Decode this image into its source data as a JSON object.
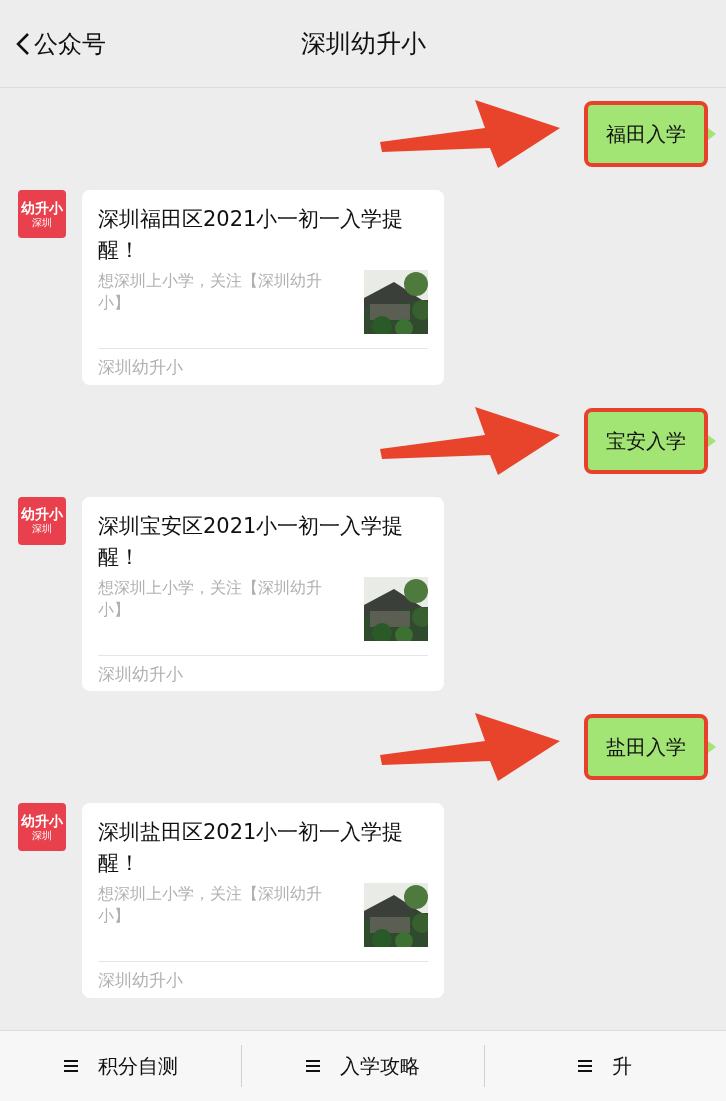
{
  "header": {
    "back_label": "公众号",
    "title": "深圳幼升小"
  },
  "messages": [
    {
      "kind": "sent",
      "text": "福田入学",
      "highlighted": true
    },
    {
      "kind": "article",
      "avatar": {
        "brand": "幼升小",
        "sub": "深圳"
      },
      "title": "深圳福田区2021小一初一入学提醒！",
      "summary": "想深圳上小学，关注【深圳幼升小】",
      "source": "深圳幼升小"
    },
    {
      "kind": "sent",
      "text": "宝安入学",
      "highlighted": true
    },
    {
      "kind": "article",
      "avatar": {
        "brand": "幼升小",
        "sub": "深圳"
      },
      "title": "深圳宝安区2021小一初一入学提醒！",
      "summary": "想深圳上小学，关注【深圳幼升小】",
      "source": "深圳幼升小"
    },
    {
      "kind": "sent",
      "text": "盐田入学",
      "highlighted": true
    },
    {
      "kind": "article",
      "avatar": {
        "brand": "幼升小",
        "sub": "深圳"
      },
      "title": "深圳盐田区2021小一初一入学提醒！",
      "summary": "想深圳上小学，关注【深圳幼升小】",
      "source": "深圳幼升小"
    }
  ],
  "menu": [
    {
      "label": "积分自测"
    },
    {
      "label": "入学攻略"
    },
    {
      "label": "升"
    }
  ]
}
